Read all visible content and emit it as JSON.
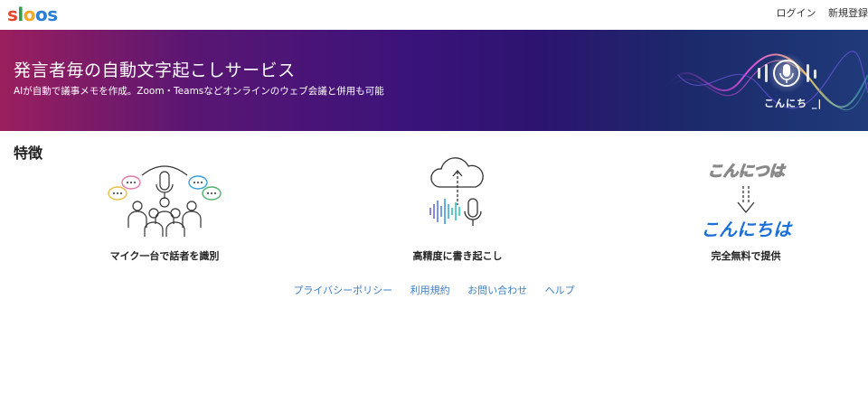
{
  "header": {
    "logo_letters": [
      "s",
      "l",
      "o",
      "o",
      "s"
    ],
    "logo_colors": [
      "#e8452c",
      "#2d9d4a",
      "#f5a623",
      "#2a7fd4",
      "#2a7fd4"
    ],
    "login_label": "ログイン",
    "signup_label": "新規登録"
  },
  "hero": {
    "title": "発言者毎の自動文字起こしサービス",
    "subtitle": "AIが自動で議事メモを作成。Zoom・Teamsなどオンラインのウェブ会議と併用も可能",
    "caption": "こんにち _|"
  },
  "features": {
    "heading": "特徴",
    "items": [
      {
        "caption": "マイク一台で話者を識別",
        "icon": "speakers-microphone-icon"
      },
      {
        "caption": "高精度に書き起こし",
        "icon": "cloud-upload-microphone-icon"
      },
      {
        "caption": "完全無料で提供",
        "icon": "text-correction-icon",
        "wrong_text": "こんにつは",
        "correct_text": "こんにちは"
      }
    ]
  },
  "footer": {
    "links": [
      "プライバシーポリシー",
      "利用規約",
      "お問い合わせ",
      "ヘルプ"
    ]
  },
  "colors": {
    "accent_link": "#3f7fc4",
    "correct_text": "#1a6fd8"
  }
}
